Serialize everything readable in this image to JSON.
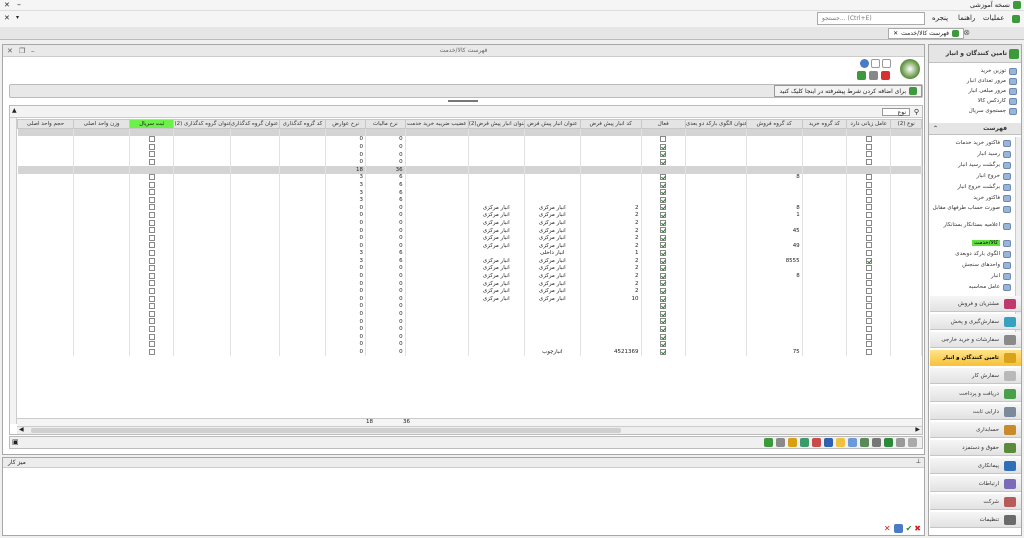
{
  "app": {
    "title": "نسخه آموزشی"
  },
  "menu": {
    "items": [
      "عملیات",
      "راهنما",
      "پنجره"
    ],
    "search_placeholder": "جستجو... (Ctrl+E)"
  },
  "doc_tab": {
    "label": "فهرست کالا/خدمت"
  },
  "window": {
    "title": "فهرست کالا/خدمت"
  },
  "filter": {
    "button_label": "برای اضافه کردن شرط پیشرفته در اینجا کلیک کنید"
  },
  "grid": {
    "type_label": "نوع",
    "columns": [
      "نوع (2)",
      "عامل زیانی دارد",
      "کد گروه خرید",
      "کد گروه فروش",
      "عنوان الگوی بارکد دو بعدی",
      "فعال",
      "کد انبار پیش فرض",
      "عنوان انبار پیش فرض",
      "عنوان انبار پیش فرض(2)",
      "عضیب ضریبه خرید خدمت",
      "نرخ مالیات",
      "نرخ عوارض",
      "کد گروه کدگذاری",
      "عنوان گروه کدگذاری",
      "عنوان گروه کدگذاری (2)",
      "ثبت سریال",
      "وزن واحد اصلی",
      "حجم واحد اصلی"
    ],
    "highlight_column": "ثبت سریال",
    "rows": [
      {
        "k": "sep"
      },
      {
        "k": "d",
        "tax": "0",
        "toll": "0"
      },
      {
        "k": "d",
        "tax": "0",
        "toll": "0",
        "active": true
      },
      {
        "k": "d",
        "tax": "0",
        "toll": "0",
        "active": true
      },
      {
        "k": "d",
        "tax": "0",
        "toll": "0",
        "active": true
      },
      {
        "k": "sep",
        "tax": "36",
        "toll": "18"
      },
      {
        "k": "d",
        "tax": "6",
        "toll": "3",
        "active": true,
        "sg": "8"
      },
      {
        "k": "d",
        "tax": "6",
        "toll": "3",
        "active": true
      },
      {
        "k": "d",
        "tax": "6",
        "toll": "3",
        "active": true
      },
      {
        "k": "d",
        "tax": "6",
        "toll": "3",
        "active": true
      },
      {
        "k": "d",
        "tax": "0",
        "toll": "0",
        "active": true,
        "sg": "8",
        "wc": "2",
        "wn": "انبار مرکزی",
        "wn2": "انبار مرکزی",
        "wn3": "انبار مرکزی"
      },
      {
        "k": "d",
        "tax": "0",
        "toll": "0",
        "active": true,
        "sg": "1",
        "wc": "2",
        "wn": "انبار مرکزی",
        "wn2": "انبار مرکزی",
        "wn3": "انبار مرکزی"
      },
      {
        "k": "d",
        "tax": "0",
        "toll": "0",
        "active": true,
        "wc": "2",
        "wn": "انبار مرکزی",
        "wn2": "انبار مرکزی",
        "wn3": "انبار مرکزی"
      },
      {
        "k": "d",
        "tax": "0",
        "toll": "0",
        "active": true,
        "sg": "45",
        "wc": "2",
        "wn": "انبار مرکزی",
        "wn2": "انبار مرکزی",
        "wn3": "انبار مرکزی"
      },
      {
        "k": "d",
        "tax": "0",
        "toll": "0",
        "active": true,
        "wc": "2",
        "wn": "انبار مرکزی",
        "wn2": "انبار مرکزی",
        "wn3": "انبار مرکزی"
      },
      {
        "k": "d",
        "tax": "0",
        "toll": "0",
        "active": true,
        "sg": "49",
        "wc": "2",
        "wn": "انبار مرکزی",
        "wn2": "انبار مرکزی",
        "wn3": "انبار مرکزی"
      },
      {
        "k": "d",
        "tax": "6",
        "toll": "3",
        "active": true,
        "wc": "1",
        "wn": "انبار داخلی",
        "wn2": "انبار داخلی"
      },
      {
        "k": "d",
        "tax": "6",
        "toll": "3",
        "active": true,
        "sg": "8555",
        "wc": "2",
        "wn": "انبار مرکزی",
        "wn2": "انبار مرکزی",
        "wn3": "انبار مرکزی",
        "loss": true
      },
      {
        "k": "d",
        "tax": "0",
        "toll": "0",
        "active": true,
        "wc": "2",
        "wn": "انبار مرکزی",
        "wn2": "انبار مرکزی",
        "wn3": "انبار مرکزی"
      },
      {
        "k": "d",
        "tax": "0",
        "toll": "0",
        "active": true,
        "sg": "8",
        "wc": "2",
        "wn": "انبار مرکزی",
        "wn2": "انبار مرکزی",
        "wn3": "انبار مرکزی"
      },
      {
        "k": "d",
        "tax": "0",
        "toll": "0",
        "active": true,
        "wc": "2",
        "wn": "انبار مرکزی",
        "wn2": "انبار مرکزی",
        "wn3": "انبار مرکزی"
      },
      {
        "k": "d",
        "tax": "0",
        "toll": "0",
        "active": true,
        "wc": "2",
        "wn": "انبار مرکزی",
        "wn2": "انبار مرکزی",
        "wn3": "انبار مرکزی"
      },
      {
        "k": "d",
        "tax": "0",
        "toll": "0",
        "active": true,
        "wc": "10",
        "wn": "انبار مرکزی",
        "wn2": "انبار مرکزی",
        "wn3": "انبار مرکزی"
      },
      {
        "k": "d",
        "tax": "0",
        "toll": "0",
        "active": true
      },
      {
        "k": "d",
        "tax": "0",
        "toll": "0",
        "active": true
      },
      {
        "k": "d",
        "tax": "0",
        "toll": "0",
        "active": true
      },
      {
        "k": "d",
        "tax": "0",
        "toll": "0",
        "active": true
      },
      {
        "k": "d",
        "tax": "0",
        "toll": "0",
        "active": true
      },
      {
        "k": "d",
        "tax": "0",
        "toll": "0",
        "active": true
      },
      {
        "k": "d",
        "tax": "0",
        "toll": "0",
        "active": true,
        "sg": "75",
        "wc": "4521369",
        "wn": "انبارچوب",
        "wn2": "انبارچوب"
      }
    ],
    "totals": {
      "tax": "36",
      "toll": "18"
    }
  },
  "notes": {
    "title": "میز کار"
  },
  "right_panel": {
    "top_title": "تامین کنندگان و انبار",
    "top_items": [
      "توزین خرید",
      "مرور تعدادی انبار",
      "مرور مبلغی انبار",
      "کاردکس کالا",
      "جستجوی سریال"
    ],
    "list_title": "فهرست",
    "list_items": [
      "فاکتور خرید خدمات",
      "رسید انبار",
      "برگشت رسید انبار",
      "خروج انبار",
      "برگشت خروج انبار",
      "فاکتور خرید",
      "صورت حساب طرفهای مقابل",
      "اعلامیه بستانکار بستانکار",
      "کالا/خدمت",
      "الگوی بارکد دوبعدی",
      "واحدهای سنجش",
      "انبار",
      "عامل محاسبه"
    ],
    "selected_item": "کالا/خدمت",
    "modules": [
      "مشتریان و فروش",
      "سفارش‌گیری و پخش",
      "سفارشات و خرید خارجی",
      "تامین کنندگان و انبار",
      "سفارش کار",
      "دریافت و پرداخت",
      "دارایی ثابت",
      "حسابداری",
      "حقوق و دستمزد",
      "پیمانکاری",
      "ارتباطات",
      "شرکت",
      "تنظیمات"
    ],
    "active_module": "تامین کنندگان و انبار",
    "module_colors": [
      "#c0396b",
      "#39a0c0",
      "#8a8a8a",
      "#d9a21b",
      "#b9b9b9",
      "#4aa04a",
      "#7a8a9a",
      "#c88a2a",
      "#5a8a3a",
      "#2f6fb8",
      "#7a6ab8",
      "#b85a5a",
      "#6a6a6a"
    ]
  }
}
